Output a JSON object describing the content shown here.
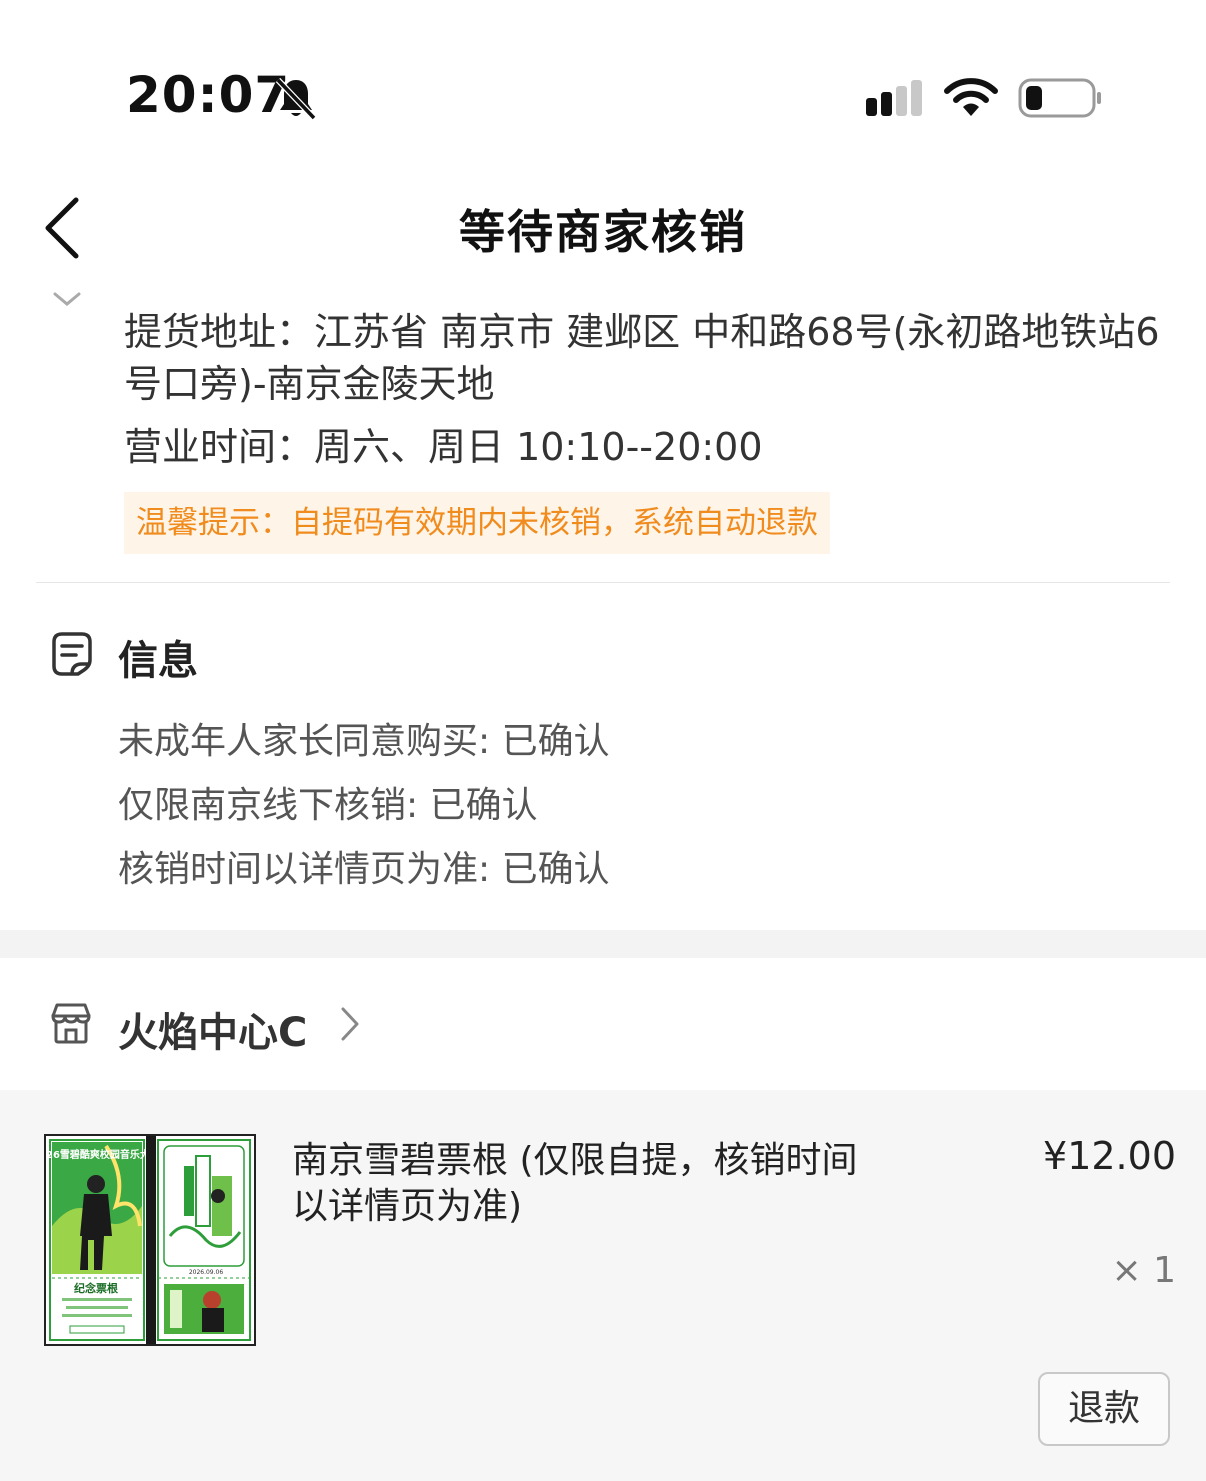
{
  "status_bar": {
    "time": "20:07"
  },
  "nav": {
    "title": "等待商家核销"
  },
  "pickup": {
    "address": "提货地址：江苏省 南京市 建邺区  中和路68号(永初路地铁站6号口旁)-南京金陵天地",
    "hours": "营业时间：周六、周日 10:10--20:00",
    "tip": "温馨提示：自提码有效期内未核销，系统自动退款"
  },
  "info": {
    "title": "信息",
    "lines": [
      "未成年人家长同意购买: 已确认",
      "仅限南京线下核销: 已确认",
      "核销时间以详情页为准: 已确认"
    ]
  },
  "shop": {
    "name": "火焰中心C"
  },
  "goods": {
    "name": "南京雪碧票根 (仅限自提，核销时间以详情页为准)",
    "price": "¥12.00",
    "quantity": "× 1",
    "refund_label": "退款",
    "thumb": {
      "banner_text": "2026雪碧酷爽校园音乐大赛",
      "stub_label": "纪念票根",
      "date": "2026.09.06"
    }
  },
  "colors": {
    "tip_text": "#f08c1e",
    "tip_bg": "#fff4e8",
    "ticket_green": "#2e9e3a"
  }
}
